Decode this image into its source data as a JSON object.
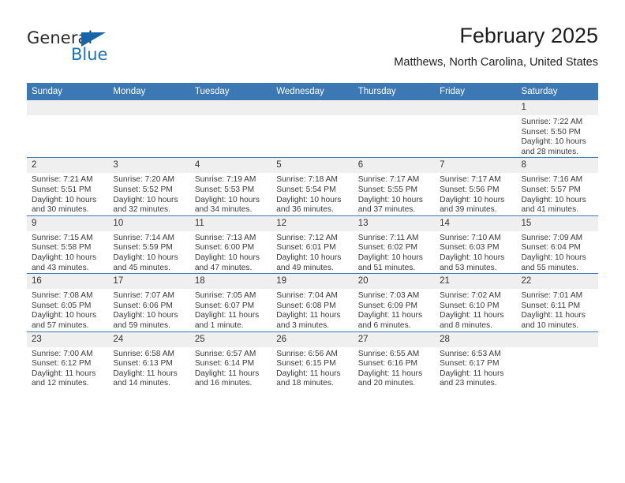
{
  "brand": {
    "name_top": "General",
    "name_bottom": "Blue",
    "triangle_icon": "triangle-icon",
    "color_dark": "#2b2b2b",
    "color_blue": "#1a73bb"
  },
  "header": {
    "title": "February 2025",
    "subtitle": "Matthews, North Carolina, United States"
  },
  "theme": {
    "header_blue": "#3b78b4",
    "day_band_gray": "#efefef",
    "row_border": "#3b78b4",
    "text": "#333333"
  },
  "labels": {
    "sunrise": "Sunrise:",
    "sunset": "Sunset:",
    "daylight": "Daylight:"
  },
  "columns": [
    "Sunday",
    "Monday",
    "Tuesday",
    "Wednesday",
    "Thursday",
    "Friday",
    "Saturday"
  ],
  "weeks": [
    [
      {
        "day": "",
        "empty": true
      },
      {
        "day": "",
        "empty": true
      },
      {
        "day": "",
        "empty": true
      },
      {
        "day": "",
        "empty": true
      },
      {
        "day": "",
        "empty": true
      },
      {
        "day": "",
        "empty": true
      },
      {
        "day": "1",
        "sunrise": "Sunrise: 7:22 AM",
        "sunset": "Sunset: 5:50 PM",
        "daylight": "Daylight: 10 hours and 28 minutes."
      }
    ],
    [
      {
        "day": "2",
        "sunrise": "Sunrise: 7:21 AM",
        "sunset": "Sunset: 5:51 PM",
        "daylight": "Daylight: 10 hours and 30 minutes."
      },
      {
        "day": "3",
        "sunrise": "Sunrise: 7:20 AM",
        "sunset": "Sunset: 5:52 PM",
        "daylight": "Daylight: 10 hours and 32 minutes."
      },
      {
        "day": "4",
        "sunrise": "Sunrise: 7:19 AM",
        "sunset": "Sunset: 5:53 PM",
        "daylight": "Daylight: 10 hours and 34 minutes."
      },
      {
        "day": "5",
        "sunrise": "Sunrise: 7:18 AM",
        "sunset": "Sunset: 5:54 PM",
        "daylight": "Daylight: 10 hours and 36 minutes."
      },
      {
        "day": "6",
        "sunrise": "Sunrise: 7:17 AM",
        "sunset": "Sunset: 5:55 PM",
        "daylight": "Daylight: 10 hours and 37 minutes."
      },
      {
        "day": "7",
        "sunrise": "Sunrise: 7:17 AM",
        "sunset": "Sunset: 5:56 PM",
        "daylight": "Daylight: 10 hours and 39 minutes."
      },
      {
        "day": "8",
        "sunrise": "Sunrise: 7:16 AM",
        "sunset": "Sunset: 5:57 PM",
        "daylight": "Daylight: 10 hours and 41 minutes."
      }
    ],
    [
      {
        "day": "9",
        "sunrise": "Sunrise: 7:15 AM",
        "sunset": "Sunset: 5:58 PM",
        "daylight": "Daylight: 10 hours and 43 minutes."
      },
      {
        "day": "10",
        "sunrise": "Sunrise: 7:14 AM",
        "sunset": "Sunset: 5:59 PM",
        "daylight": "Daylight: 10 hours and 45 minutes."
      },
      {
        "day": "11",
        "sunrise": "Sunrise: 7:13 AM",
        "sunset": "Sunset: 6:00 PM",
        "daylight": "Daylight: 10 hours and 47 minutes."
      },
      {
        "day": "12",
        "sunrise": "Sunrise: 7:12 AM",
        "sunset": "Sunset: 6:01 PM",
        "daylight": "Daylight: 10 hours and 49 minutes."
      },
      {
        "day": "13",
        "sunrise": "Sunrise: 7:11 AM",
        "sunset": "Sunset: 6:02 PM",
        "daylight": "Daylight: 10 hours and 51 minutes."
      },
      {
        "day": "14",
        "sunrise": "Sunrise: 7:10 AM",
        "sunset": "Sunset: 6:03 PM",
        "daylight": "Daylight: 10 hours and 53 minutes."
      },
      {
        "day": "15",
        "sunrise": "Sunrise: 7:09 AM",
        "sunset": "Sunset: 6:04 PM",
        "daylight": "Daylight: 10 hours and 55 minutes."
      }
    ],
    [
      {
        "day": "16",
        "sunrise": "Sunrise: 7:08 AM",
        "sunset": "Sunset: 6:05 PM",
        "daylight": "Daylight: 10 hours and 57 minutes."
      },
      {
        "day": "17",
        "sunrise": "Sunrise: 7:07 AM",
        "sunset": "Sunset: 6:06 PM",
        "daylight": "Daylight: 10 hours and 59 minutes."
      },
      {
        "day": "18",
        "sunrise": "Sunrise: 7:05 AM",
        "sunset": "Sunset: 6:07 PM",
        "daylight": "Daylight: 11 hours and 1 minute."
      },
      {
        "day": "19",
        "sunrise": "Sunrise: 7:04 AM",
        "sunset": "Sunset: 6:08 PM",
        "daylight": "Daylight: 11 hours and 3 minutes."
      },
      {
        "day": "20",
        "sunrise": "Sunrise: 7:03 AM",
        "sunset": "Sunset: 6:09 PM",
        "daylight": "Daylight: 11 hours and 6 minutes."
      },
      {
        "day": "21",
        "sunrise": "Sunrise: 7:02 AM",
        "sunset": "Sunset: 6:10 PM",
        "daylight": "Daylight: 11 hours and 8 minutes."
      },
      {
        "day": "22",
        "sunrise": "Sunrise: 7:01 AM",
        "sunset": "Sunset: 6:11 PM",
        "daylight": "Daylight: 11 hours and 10 minutes."
      }
    ],
    [
      {
        "day": "23",
        "sunrise": "Sunrise: 7:00 AM",
        "sunset": "Sunset: 6:12 PM",
        "daylight": "Daylight: 11 hours and 12 minutes."
      },
      {
        "day": "24",
        "sunrise": "Sunrise: 6:58 AM",
        "sunset": "Sunset: 6:13 PM",
        "daylight": "Daylight: 11 hours and 14 minutes."
      },
      {
        "day": "25",
        "sunrise": "Sunrise: 6:57 AM",
        "sunset": "Sunset: 6:14 PM",
        "daylight": "Daylight: 11 hours and 16 minutes."
      },
      {
        "day": "26",
        "sunrise": "Sunrise: 6:56 AM",
        "sunset": "Sunset: 6:15 PM",
        "daylight": "Daylight: 11 hours and 18 minutes."
      },
      {
        "day": "27",
        "sunrise": "Sunrise: 6:55 AM",
        "sunset": "Sunset: 6:16 PM",
        "daylight": "Daylight: 11 hours and 20 minutes."
      },
      {
        "day": "28",
        "sunrise": "Sunrise: 6:53 AM",
        "sunset": "Sunset: 6:17 PM",
        "daylight": "Daylight: 11 hours and 23 minutes."
      },
      {
        "day": "",
        "empty": true
      }
    ]
  ]
}
